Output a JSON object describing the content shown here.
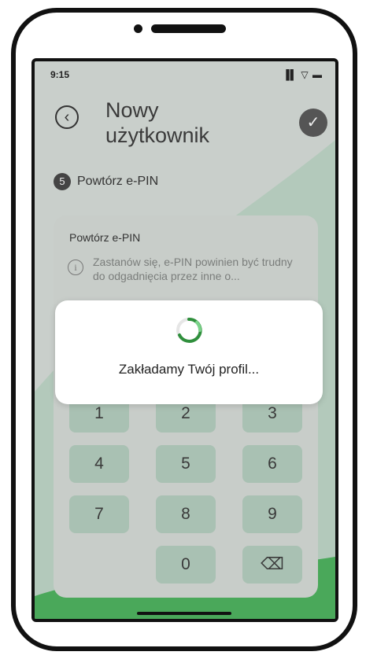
{
  "status": {
    "time": "9:15",
    "icons": "▐▌ ▽ ▬"
  },
  "header": {
    "title_line1": "Nowy",
    "title_line2": "użytkownik",
    "back_icon": "‹",
    "confirm_icon": "✓"
  },
  "step": {
    "number": "5",
    "label": "Powtórz e-PIN"
  },
  "card": {
    "title": "Powtórz e-PIN",
    "hint": "Zastanów się, e-PIN powinien być trudny do odgadnięcia przez inne o..."
  },
  "keypad": {
    "keys": [
      "1",
      "2",
      "3",
      "4",
      "5",
      "6",
      "7",
      "8",
      "9",
      "0"
    ],
    "backspace_icon": "⌫"
  },
  "modal": {
    "message": "Zakładamy Twój profil..."
  },
  "colors": {
    "accent": "#3cb44a",
    "dim_overlay": "#c9cfcb"
  }
}
